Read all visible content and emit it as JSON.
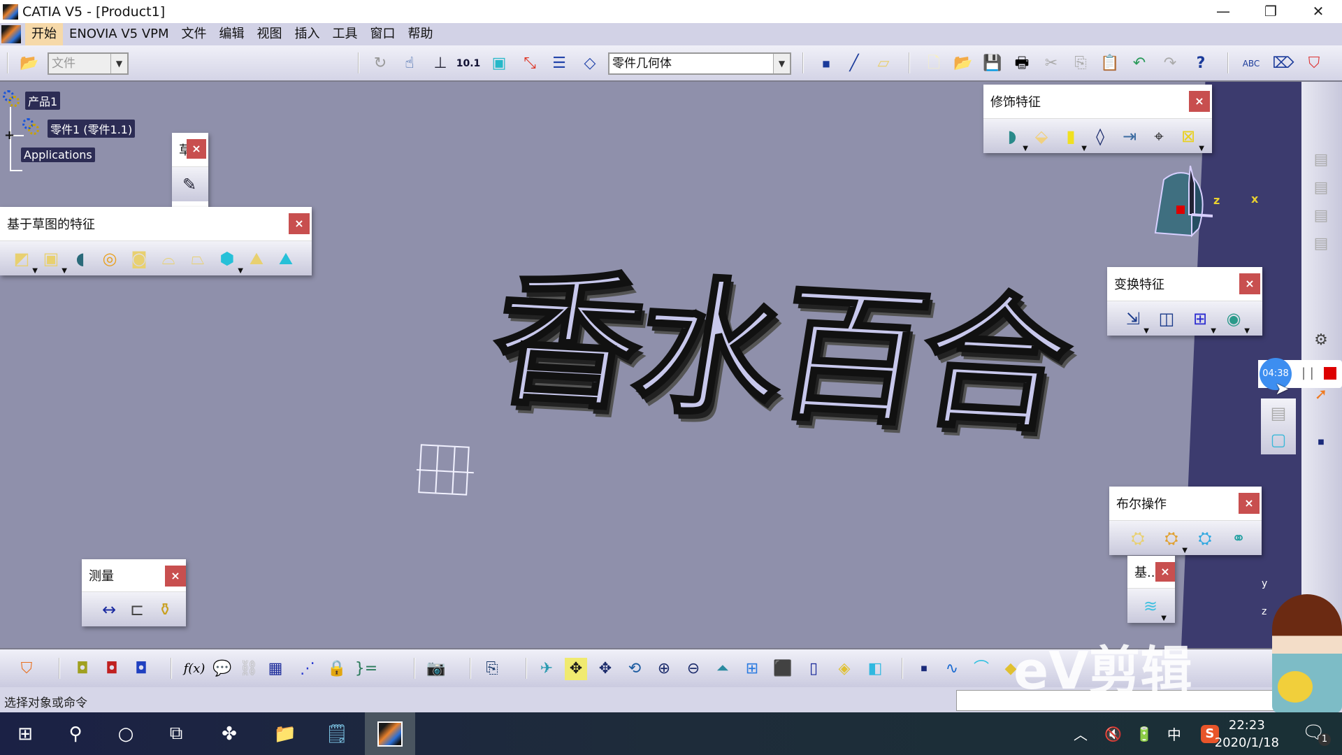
{
  "window": {
    "title": "CATIA V5 - [Product1]",
    "controls": [
      "minimize",
      "restore",
      "close"
    ]
  },
  "menubar": {
    "items": [
      "开始",
      "ENOVIA V5 VPM",
      "文件",
      "编辑",
      "视图",
      "插入",
      "工具",
      "窗口",
      "帮助"
    ],
    "active_item": "开始"
  },
  "toolbar_top": {
    "file_combo": "文件",
    "workbench_combo": "零件几何体",
    "icons": [
      "open-folder-icon",
      "update-icon",
      "hand-select-icon",
      "axis-system-icon",
      "measure-value-icon",
      "body-icon",
      "link-icon",
      "list-icon",
      "plane-body-icon",
      "point-icon",
      "line-icon",
      "plane-icon",
      "new-icon",
      "open-icon",
      "save-icon",
      "print-icon",
      "cut-icon",
      "copy-icon",
      "paste-icon",
      "undo-icon",
      "redo-icon",
      "whats-this-icon",
      "text-annotation-icon",
      "flag-note-icon",
      "stamp-icon"
    ]
  },
  "spec_tree": {
    "nodes": [
      {
        "label": "产品1",
        "type": "product"
      },
      {
        "label": "零件1 (零件1.1)",
        "type": "part",
        "expandable": true
      },
      {
        "label": "Applications",
        "type": "applications"
      }
    ]
  },
  "panels": {
    "sketcher": {
      "title": "草",
      "icons": [
        "sketch-icon"
      ]
    },
    "sketch_based": {
      "title": "基于草图的特征",
      "icons": [
        "pad-icon",
        "pocket-icon",
        "shaft-icon",
        "groove-icon",
        "hole-icon",
        "rib-icon",
        "slot-icon",
        "stiffener-icon",
        "multi-sections-solid-icon",
        "removed-multi-sections-icon"
      ]
    },
    "dress_up": {
      "title": "修饰特征",
      "icons": [
        "edge-fillet-icon",
        "chamfer-icon",
        "draft-icon",
        "shell-icon",
        "thickness-icon",
        "thread-icon",
        "remove-face-icon"
      ]
    },
    "transform": {
      "title": "变换特征",
      "icons": [
        "translation-icon",
        "mirror-icon",
        "rectangular-pattern-icon",
        "scaling-icon"
      ]
    },
    "boolean": {
      "title": "布尔操作",
      "icons": [
        "assemble-icon",
        "add-icon",
        "remove-icon",
        "union-trim-icon"
      ]
    },
    "surface_based": {
      "title": "基...",
      "icons": [
        "split-icon"
      ]
    },
    "measure": {
      "title": "测量",
      "icons": [
        "measure-between-icon",
        "measure-item-icon",
        "measure-inertia-icon"
      ]
    }
  },
  "viewport": {
    "model_text": "香水百合",
    "compass_labels": {
      "x": "x",
      "y": "y",
      "z": "z"
    }
  },
  "toolbar_bottom": {
    "icons": [
      "catalog-icon",
      "constraint-icon",
      "constraint-anchor-icon",
      "constraint-update-icon",
      "formula-icon",
      "comment-icon",
      "chain-icon",
      "design-table-icon",
      "law-icon",
      "lock-icon",
      "equations-icon",
      "capture-icon",
      "macro-icon",
      "fly-mode-icon",
      "fit-all-icon",
      "pan-icon",
      "rotate-icon",
      "zoom-in-icon",
      "zoom-out-icon",
      "normal-view-icon",
      "multi-view-icon",
      "iso-view-icon",
      "shading-icon",
      "hide-show-icon",
      "swap-space-icon",
      "point-icon",
      "spline-icon",
      "surface-icon",
      "3d-axis-icon"
    ]
  },
  "status": {
    "prompt": "选择对象或命令",
    "input_value": ""
  },
  "recorder": {
    "time": "04:38"
  },
  "watermark": "eV剪辑",
  "taskbar": {
    "icons": [
      "windows-start-icon",
      "search-icon",
      "cortana-icon",
      "task-view-icon",
      "app-fan-icon",
      "file-explorer-icon",
      "notepad-icon",
      "catia-icon"
    ],
    "active": "catia-icon",
    "tray": {
      "ime": "中",
      "time": "22:23",
      "date": "2020/1/18",
      "notifications": "1"
    }
  }
}
